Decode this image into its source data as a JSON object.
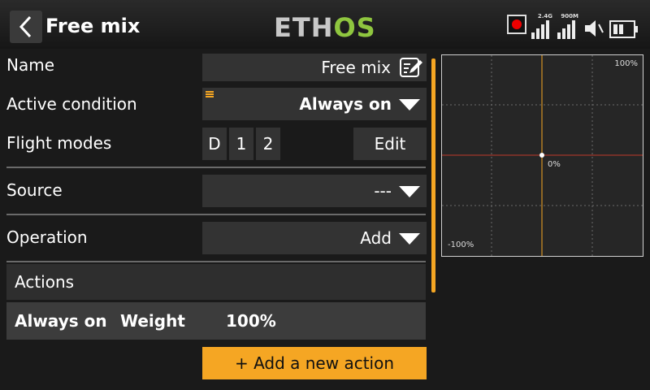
{
  "header": {
    "title": "Free mix",
    "logo_left": "ETH",
    "logo_right": "OS",
    "signal1_tag": "2.4G",
    "signal2_tag": "900M"
  },
  "form": {
    "name_label": "Name",
    "name_value": "Free mix",
    "active_condition_label": "Active condition",
    "active_condition_value": "Always on",
    "flight_modes_label": "Flight modes",
    "flight_modes": [
      "D",
      "1",
      "2"
    ],
    "edit_label": "Edit",
    "source_label": "Source",
    "source_value": "---",
    "operation_label": "Operation",
    "operation_value": "Add"
  },
  "actions": {
    "header": "Actions",
    "row": {
      "condition": "Always on",
      "type": "Weight",
      "value": "100%"
    },
    "add_label": "+ Add a new action"
  },
  "graph": {
    "top_label": "100%",
    "center_label": "0%",
    "bottom_label": "-100%",
    "point": {
      "x": 0,
      "y": 0
    }
  },
  "colors": {
    "accent": "#f5a623",
    "logo_green": "#8fc63f",
    "curve_red": "#c0392b",
    "record": "#e00000"
  }
}
